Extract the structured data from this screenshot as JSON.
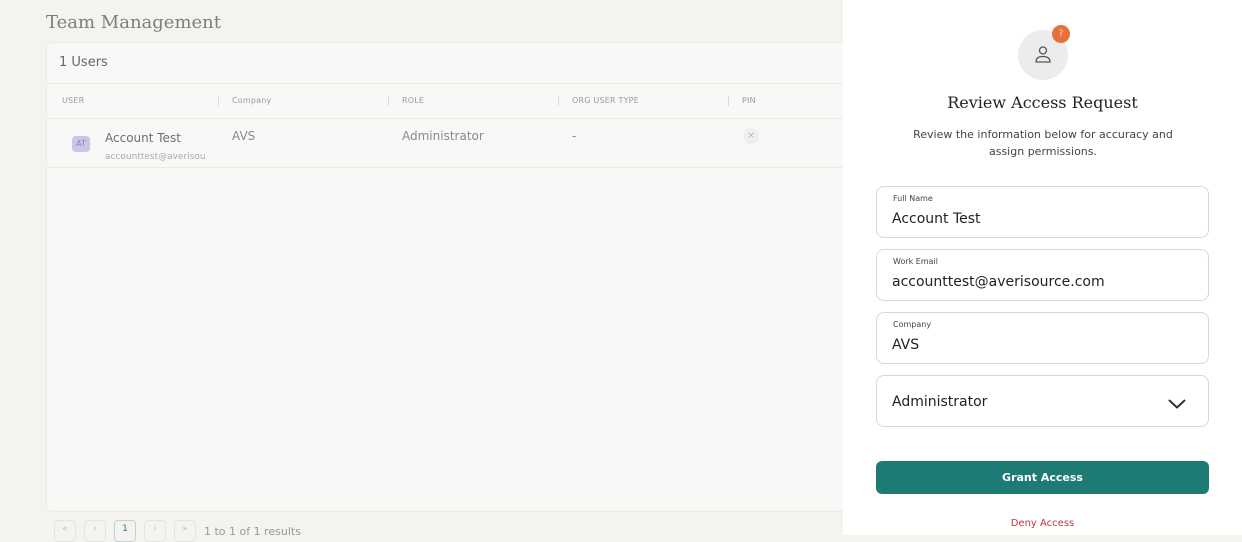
{
  "page": {
    "title": "Team Management"
  },
  "table": {
    "count_label": "1 Users",
    "columns": [
      "USER",
      "Company",
      "ROLE",
      "ORG USER TYPE",
      "PIN"
    ],
    "rows": [
      {
        "initials": "AT",
        "name": "Account Test",
        "email": "accounttest@averisource",
        "company": "AVS",
        "role": "Administrator",
        "org_user_type": "-",
        "pin": "×"
      }
    ]
  },
  "pagination": {
    "first": "«",
    "prev": "‹",
    "current": "1",
    "next": "›",
    "last": "»",
    "info": "1 to 1 of 1 results"
  },
  "panel": {
    "badge": "?",
    "icon": "user-icon",
    "title": "Review Access Request",
    "subtitle": "Review the information below for accuracy and assign permissions.",
    "fields": {
      "full_name": {
        "label": "Full Name",
        "value": "Account Test"
      },
      "work_email": {
        "label": "Work Email",
        "value": "accounttest@averisource.com"
      },
      "company": {
        "label": "Company",
        "value": "AVS"
      }
    },
    "role_select": {
      "value": "Administrator"
    },
    "grant_label": "Grant Access",
    "deny_label": "Deny Access"
  },
  "colors": {
    "accent": "#1e7a74",
    "deny": "#c9323a",
    "badge": "#e8703a"
  }
}
